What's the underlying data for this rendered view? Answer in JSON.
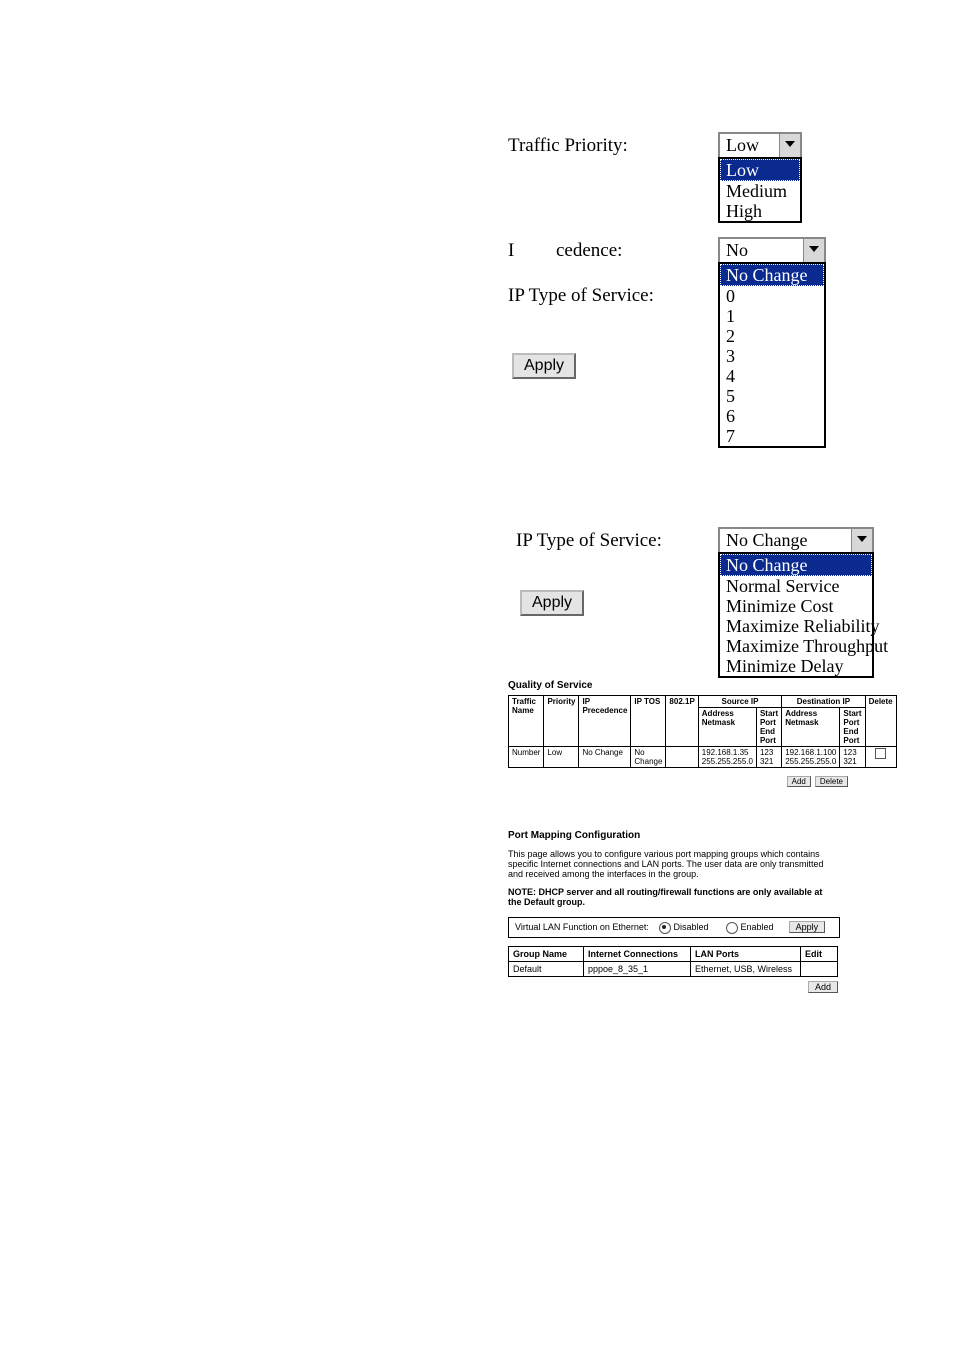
{
  "section1": {
    "traffic_priority_label": "Traffic Priority:",
    "traffic_priority_value": "Low",
    "traffic_priority_options": [
      "Low",
      "Medium",
      "High"
    ],
    "ip_precedence_label_fragment_left": "I",
    "ip_precedence_label_fragment_right": "cedence:",
    "ip_precedence_value": "No Change",
    "ip_precedence_options": [
      "No Change",
      "0",
      "1",
      "2",
      "3",
      "4",
      "5",
      "6",
      "7"
    ],
    "ip_tos_label": "IP Type of Service:",
    "apply_label": "Apply"
  },
  "section2": {
    "ip_tos_label": "IP Type of Service:",
    "ip_tos_value": "No Change",
    "ip_tos_options": [
      "No Change",
      "Normal Service",
      "Minimize Cost",
      "Maximize Reliability",
      "Maximize Throughput",
      "Minimize Delay"
    ],
    "apply_label": "Apply"
  },
  "qos": {
    "title": "Quality of Service",
    "headers": {
      "traffic_name": "Traffic Name",
      "priority": "Priority",
      "ip_precedence": "IP Precedence",
      "ip_tos": "IP TOS",
      "p8021": "802.1P",
      "source_ip": "Source IP",
      "address": "Address",
      "netmask": "Netmask",
      "start_port": "Start Port",
      "end_port": "End Port",
      "destination_ip": "Destination IP",
      "delete": "Delete"
    },
    "row": {
      "traffic_name": "Number",
      "priority": "Low",
      "ip_precedence": "No Change",
      "ip_tos": "No Change",
      "p8021": "",
      "src_addr": "192.168.1.35",
      "src_mask": "255.255.255.0",
      "src_start": "123",
      "src_end": "321",
      "dst_addr": "192.168.1.100",
      "dst_mask": "255.255.255.0",
      "dst_start": "123",
      "dst_end": "321"
    },
    "add_label": "Add",
    "delete_label": "Delete"
  },
  "port_mapping": {
    "title": "Port Mapping Configuration",
    "desc": "This page allows you to configure various port mapping groups which contains specific Internet connections and LAN ports. The user data are only transmitted and received among the interfaces in the group.",
    "note": "NOTE: DHCP server and all routing/firewall functions are only available at the Default group.",
    "vlan_label": "Virtual LAN Function on Ethernet:",
    "disabled_label": "Disabled",
    "enabled_label": "Enabled",
    "apply_label": "Apply",
    "headers": {
      "group_name": "Group Name",
      "internet": "Internet Connections",
      "lan": "LAN Ports",
      "edit": "Edit"
    },
    "row": {
      "group_name": "Default",
      "internet": "pppoe_8_35_1",
      "lan": "Ethernet, USB, Wireless"
    },
    "add_label": "Add"
  }
}
